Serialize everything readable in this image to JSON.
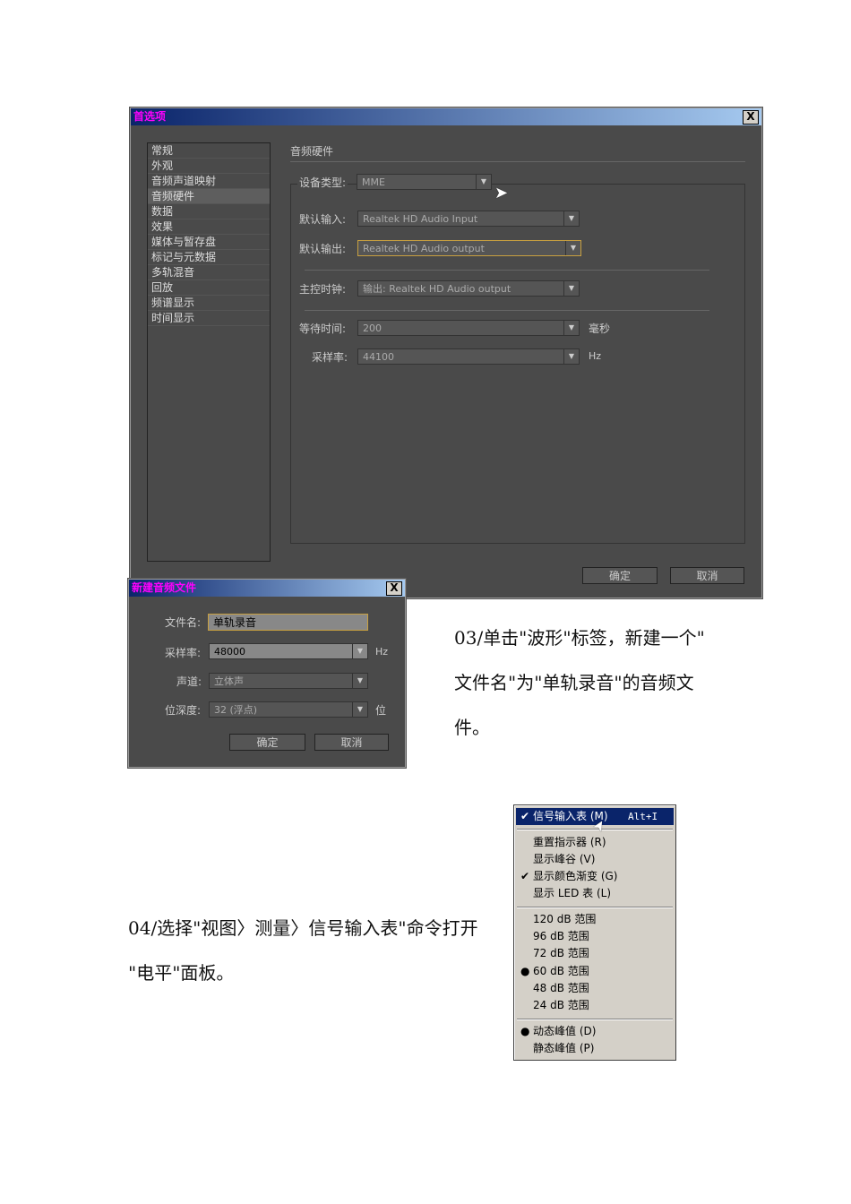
{
  "prefs": {
    "title": "首选项",
    "close": "X",
    "nav": [
      "常规",
      "外观",
      "音频声道映射",
      "音频硬件",
      "数据",
      "效果",
      "媒体与暂存盘",
      "标记与元数据",
      "多轨混音",
      "回放",
      "频谱显示",
      "时间显示"
    ],
    "section": "音频硬件",
    "device_type_label": "设备类型:",
    "device_type": "MME",
    "input_label": "默认输入:",
    "input": "Realtek HD Audio Input",
    "output_label": "默认输出:",
    "output": "Realtek HD Audio output",
    "clock_label": "主控时钟:",
    "clock": "输出: Realtek HD Audio output",
    "latency_label": "等待时间:",
    "latency": "200",
    "latency_unit": "毫秒",
    "rate_label": "采样率:",
    "rate": "44100",
    "rate_unit": "Hz",
    "ok": "确定",
    "cancel": "取消"
  },
  "newfile": {
    "title": "新建音频文件",
    "close": "X",
    "name_label": "文件名:",
    "name": "单轨录音",
    "rate_label": "采样率:",
    "rate": "48000",
    "rate_unit": "Hz",
    "channel_label": "声道:",
    "channel": "立体声",
    "depth_label": "位深度:",
    "depth": "32 (浮点)",
    "depth_unit": "位",
    "ok": "确定",
    "cancel": "取消"
  },
  "step03": [
    "03/单击\"波形\"标签，新建一个\"",
    "文件名\"为\"单轨录音\"的音频文",
    "件。"
  ],
  "step04": [
    "04/选择\"视图〉测量〉信号输入表\"命令打开",
    "\"电平\"面板。"
  ],
  "menu": {
    "items": [
      {
        "label": "信号输入表 (M)",
        "shortcut": "Alt+I",
        "mark": "✔"
      },
      {
        "label": "重置指示器 (R)",
        "mark": ""
      },
      {
        "label": "显示峰谷 (V)",
        "mark": ""
      },
      {
        "label": "显示颜色渐变 (G)",
        "mark": "✔"
      },
      {
        "label": "显示 LED 表 (L)",
        "mark": ""
      },
      {
        "label": "120 dB 范围",
        "mark": ""
      },
      {
        "label": "96 dB 范围",
        "mark": ""
      },
      {
        "label": "72 dB 范围",
        "mark": ""
      },
      {
        "label": "60 dB 范围",
        "mark": "●"
      },
      {
        "label": "48 dB 范围",
        "mark": ""
      },
      {
        "label": "24 dB 范围",
        "mark": ""
      },
      {
        "label": "动态峰值 (D)",
        "mark": "●"
      },
      {
        "label": "静态峰值 (P)",
        "mark": ""
      }
    ]
  }
}
